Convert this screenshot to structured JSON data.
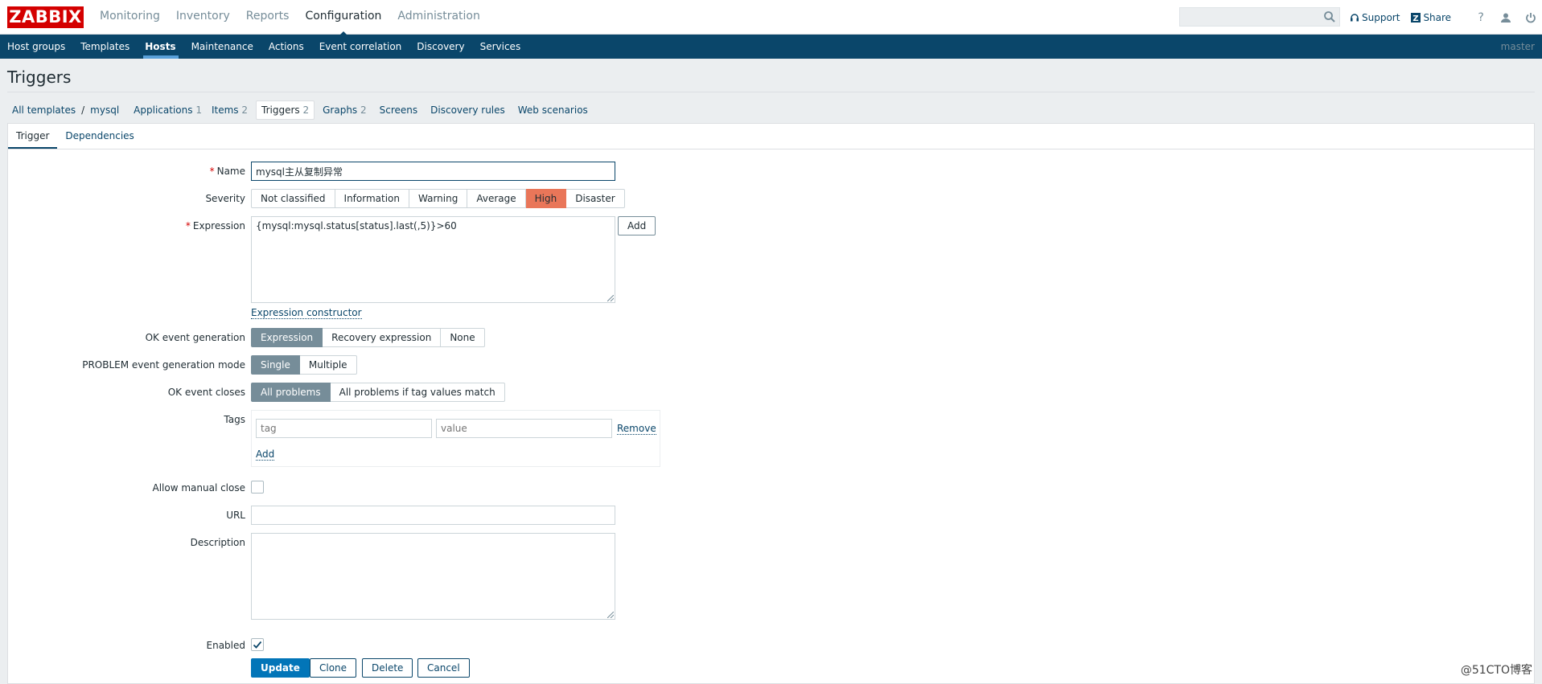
{
  "header": {
    "logo": "ZABBIX",
    "menu": [
      "Monitoring",
      "Inventory",
      "Reports",
      "Configuration",
      "Administration"
    ],
    "search_placeholder": "",
    "support": "Support",
    "share": "Share",
    "help": "?"
  },
  "submenu": {
    "items": [
      "Host groups",
      "Templates",
      "Hosts",
      "Maintenance",
      "Actions",
      "Event correlation",
      "Discovery",
      "Services"
    ],
    "server": "master"
  },
  "page": {
    "title": "Triggers"
  },
  "breadcrumbs": {
    "all_templates": "All templates",
    "sep": "/",
    "template": "mysql",
    "applications": "Applications",
    "applications_count": "1",
    "items": "Items",
    "items_count": "2",
    "triggers": "Triggers",
    "triggers_count": "2",
    "graphs": "Graphs",
    "graphs_count": "2",
    "screens": "Screens",
    "discovery_rules": "Discovery rules",
    "web_scenarios": "Web scenarios"
  },
  "tabs": [
    "Trigger",
    "Dependencies"
  ],
  "form": {
    "name_label": "Name",
    "name_value": "mysql主从复制异常",
    "severity_label": "Severity",
    "severity_options": [
      "Not classified",
      "Information",
      "Warning",
      "Average",
      "High",
      "Disaster"
    ],
    "severity_selected": "High",
    "expression_label": "Expression",
    "expression_value": "{mysql:mysql.status[status].last(,5)}>60",
    "expression_add": "Add",
    "expression_constructor": "Expression constructor",
    "ok_event_generation_label": "OK event generation",
    "ok_event_generation_options": [
      "Expression",
      "Recovery expression",
      "None"
    ],
    "problem_mode_label": "PROBLEM event generation mode",
    "problem_mode_options": [
      "Single",
      "Multiple"
    ],
    "ok_event_closes_label": "OK event closes",
    "ok_event_closes_options": [
      "All problems",
      "All problems if tag values match"
    ],
    "tags_label": "Tags",
    "tag_placeholder": "tag",
    "value_placeholder": "value",
    "tag_remove": "Remove",
    "tag_add": "Add",
    "allow_manual_close_label": "Allow manual close",
    "url_label": "URL",
    "url_value": "",
    "description_label": "Description",
    "description_value": "",
    "enabled_label": "Enabled",
    "enabled": true,
    "buttons": {
      "update": "Update",
      "clone": "Clone",
      "delete": "Delete",
      "cancel": "Cancel"
    }
  },
  "watermark": "@51CTO博客"
}
